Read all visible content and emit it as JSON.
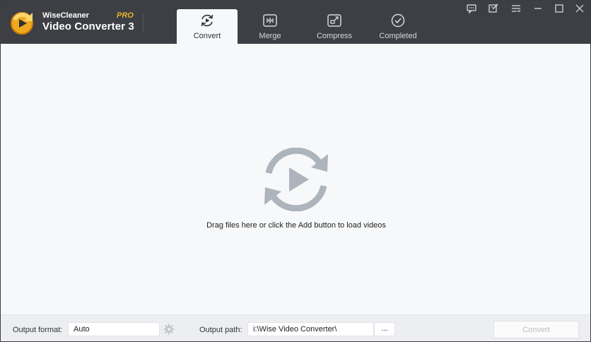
{
  "app": {
    "brand_line1": "WiseCleaner",
    "brand_line2": "Video Converter 3",
    "edition": "PRO"
  },
  "tabs": [
    {
      "label": "Convert",
      "icon": "convert-icon",
      "active": true
    },
    {
      "label": "Merge",
      "icon": "merge-icon",
      "active": false
    },
    {
      "label": "Compress",
      "icon": "compress-icon",
      "active": false
    },
    {
      "label": "Completed",
      "icon": "completed-icon",
      "active": false
    }
  ],
  "window_controls": [
    "feedback-icon",
    "register-icon",
    "menu-icon",
    "minimize-icon",
    "maximize-icon",
    "close-icon"
  ],
  "main": {
    "hint": "Drag files here or click the Add button to load videos",
    "icon": "convert-video-icon"
  },
  "bottom": {
    "output_format_label": "Output format:",
    "output_format_value": "Auto",
    "output_path_label": "Output path:",
    "output_path_value": "i:\\Wise Video Converter\\",
    "browse_label": "...",
    "convert_label": "Convert"
  },
  "colors": {
    "titlebar": "#3d3f44",
    "accent": "#e9b529",
    "icon_gray": "#aeb4bc"
  }
}
